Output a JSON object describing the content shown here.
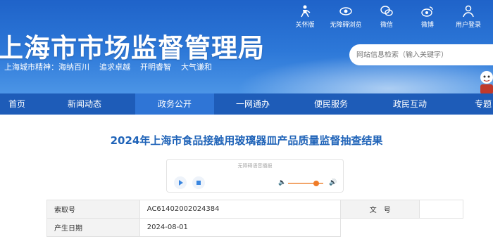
{
  "header": {
    "site_title": "上海市市场监督管理局",
    "spirit_label": "上海城市精神：",
    "spirit_items": [
      "海纳百川",
      "追求卓越",
      "开明睿智",
      "大气谦和"
    ],
    "tools": [
      {
        "label": "关怀版",
        "icon": "elderly-care-icon"
      },
      {
        "label": "无障碍浏览",
        "icon": "eye-icon"
      },
      {
        "label": "微信",
        "icon": "wechat-icon"
      },
      {
        "label": "微博",
        "icon": "weibo-icon"
      },
      {
        "label": "用户登录",
        "icon": "user-icon"
      }
    ],
    "search_placeholder": "网站信息检索（输入关键字）"
  },
  "nav": {
    "items": [
      "首页",
      "新闻动态",
      "政务公开",
      "一网通办",
      "便民服务",
      "政民互动",
      "专题"
    ],
    "active": "政务公开"
  },
  "article": {
    "title": "2024年上海市食品接触用玻璃器皿产品质量监督抽查结果"
  },
  "player": {
    "label": "无障碍语音播报",
    "volume_level": 0.8
  },
  "meta": {
    "index_label": "索取号",
    "index_value": "AC61402002024384",
    "doc_no_label": "文　号",
    "doc_no_value": "",
    "date_label": "产生日期",
    "date_value": "2024-08-01"
  },
  "colors": {
    "header_blue": "#1f63c9",
    "nav_blue": "#1e5cb8",
    "nav_active": "#2f75d6",
    "title_blue": "#1f63b8"
  }
}
